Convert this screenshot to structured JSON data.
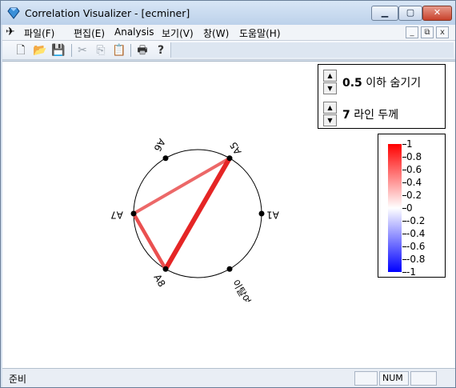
{
  "window": {
    "title": "Correlation Visualizer - [ecminer]",
    "minimize_glyph": "▁",
    "maximize_glyph": "▢",
    "close_glyph": "✕"
  },
  "menu": {
    "items": [
      "파일(F)",
      "편집(E)",
      "Analysis",
      "보기(V)",
      "창(W)",
      "도움말(H)"
    ],
    "mdi_controls": [
      "_",
      "⧉",
      "x"
    ]
  },
  "toolbar": {
    "icons": [
      "new-file-icon",
      "open-folder-icon",
      "save-icon",
      "cut-icon",
      "copy-icon",
      "paste-icon",
      "print-icon",
      "help-icon"
    ]
  },
  "controls": {
    "hide_threshold_value": "0.5",
    "hide_threshold_text": " 이하 숨기기",
    "line_width_value": "7",
    "line_width_text": " 라인 두께"
  },
  "chart_data": {
    "type": "network",
    "nodes": [
      "A1",
      "A5",
      "A6",
      "A7",
      "A8",
      "이탈여부"
    ],
    "edges": [
      {
        "from": "A5",
        "to": "A7"
      },
      {
        "from": "A5",
        "to": "A8"
      },
      {
        "from": "A7",
        "to": "A8"
      }
    ]
  },
  "legend": {
    "labels": [
      "1",
      "0.8",
      "0.6",
      "0.4",
      "0.2",
      "0",
      "-0.2",
      "-0.4",
      "-0.6",
      "-0.8",
      "-1"
    ],
    "colors": {
      "max": "#ff0000",
      "mid": "#ffffff",
      "min": "#0000ff"
    }
  },
  "status": {
    "text": "준비",
    "num": "NUM"
  }
}
